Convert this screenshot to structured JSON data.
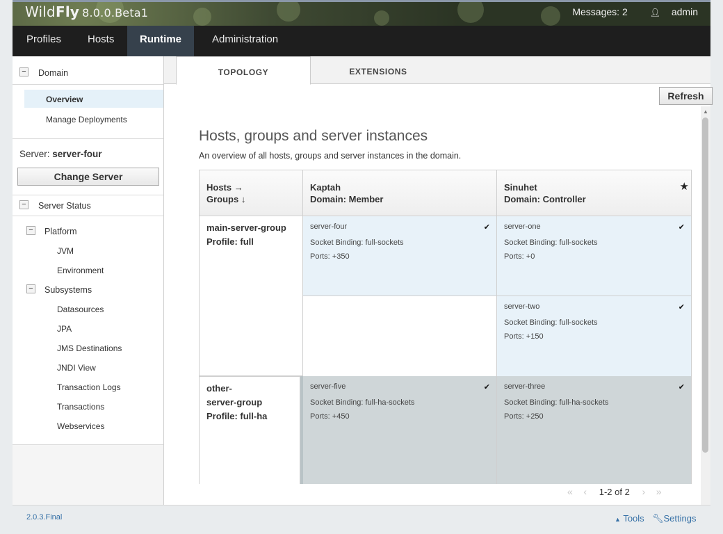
{
  "app": {
    "logo_light": "Wild",
    "logo_bold": "Fly",
    "version": "8.0.0.Beta1",
    "messages": "Messages: 2",
    "user": "admin"
  },
  "nav": {
    "items": [
      "Profiles",
      "Hosts",
      "Runtime",
      "Administration"
    ],
    "active": "Runtime"
  },
  "sidebar": {
    "domain_label": "Domain",
    "overview": "Overview",
    "manage_deployments": "Manage Deployments",
    "server_prefix": "Server:",
    "server_name": "server-four",
    "change_server": "Change Server",
    "server_status": "Server Status",
    "platform": "Platform",
    "platform_items": [
      "JVM",
      "Environment"
    ],
    "subsystems": "Subsystems",
    "subsystem_items": [
      "Datasources",
      "JPA",
      "JMS Destinations",
      "JNDI View",
      "Transaction Logs",
      "Transactions",
      "Webservices"
    ]
  },
  "tabs": [
    "TOPOLOGY",
    "EXTENSIONS"
  ],
  "refresh": "Refresh",
  "page": {
    "title": "Hosts, groups and server instances",
    "description": "An overview of all hosts, groups and server instances in the domain."
  },
  "topology": {
    "corner_line1": "Hosts →",
    "corner_line2": "Groups ↓",
    "hosts": [
      {
        "name": "Kaptah",
        "domain": "Domain: Member"
      },
      {
        "name": "Sinuhet",
        "domain": "Domain: Controller"
      }
    ],
    "groups": [
      {
        "line1": "main-server-group",
        "line2": "Profile: full"
      },
      {
        "line1": "other-",
        "line2": "server-group",
        "line3": "Profile: full-ha"
      }
    ],
    "servers": {
      "s4": {
        "name": "server-four",
        "binding": "Socket Binding: full-sockets",
        "ports": "Ports: +350"
      },
      "s1": {
        "name": "server-one",
        "binding": "Socket Binding: full-sockets",
        "ports": "Ports: +0"
      },
      "s2": {
        "name": "server-two",
        "binding": "Socket Binding: full-sockets",
        "ports": "Ports: +150"
      },
      "s5": {
        "name": "server-five",
        "binding": "Socket Binding: full-ha-sockets",
        "ports": "Ports: +450"
      },
      "s3": {
        "name": "server-three",
        "binding": "Socket Binding: full-ha-sockets",
        "ports": "Ports: +250"
      }
    }
  },
  "pager": {
    "text": "1-2 of 2"
  },
  "footer": {
    "version": "2.0.3.Final",
    "tools": "Tools",
    "settings": "Settings"
  },
  "colors": {
    "accent_selected": "#e5f1f9",
    "server_light": "#e8f2f9",
    "server_grey": "#cfd6d8",
    "nav_active": "#36414c",
    "link": "#3570a6"
  }
}
